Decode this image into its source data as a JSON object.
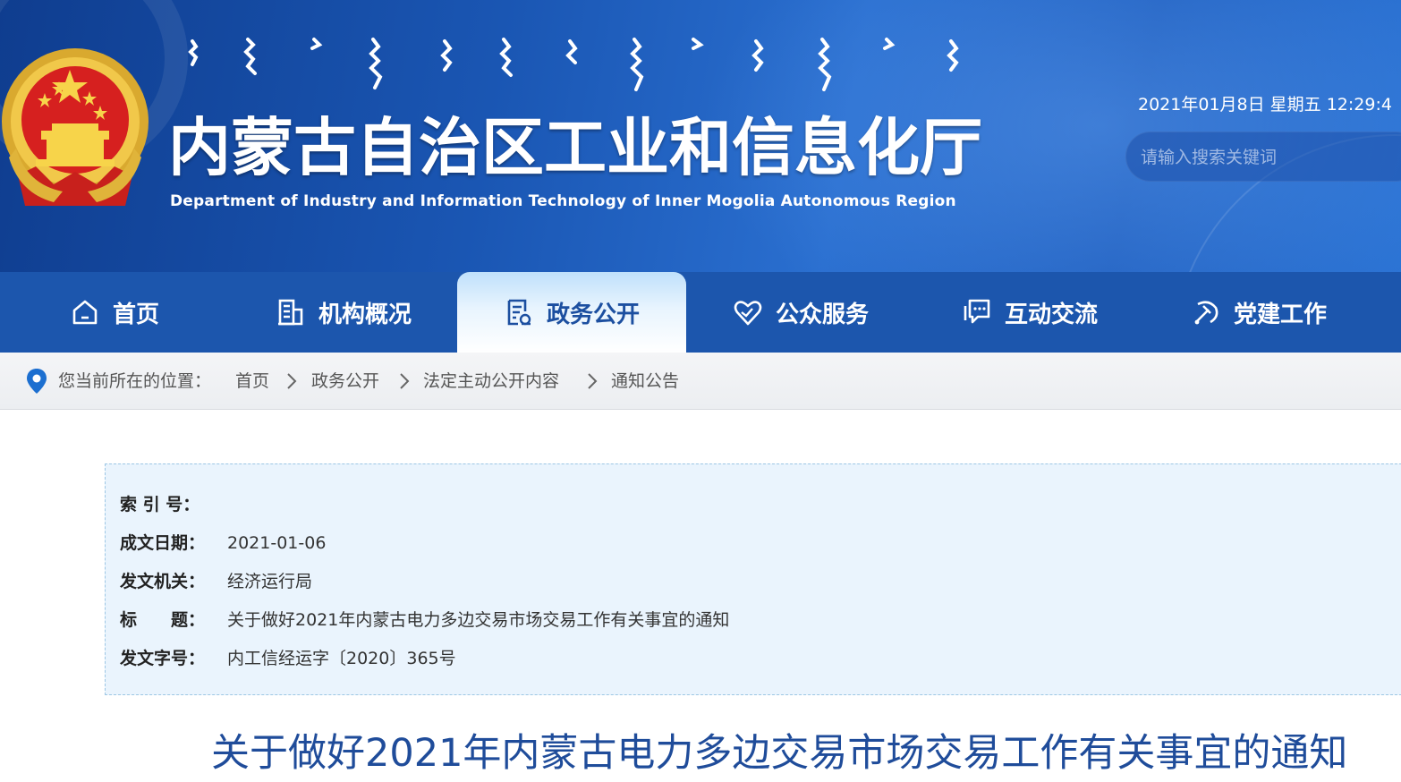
{
  "header": {
    "title_cn": "内蒙古自治区工业和信息化厅",
    "title_en": "Department of Industry and Information Technology of Inner Mogolia Autonomous Region",
    "datetime": "2021年01月8日 星期五 12:29:4",
    "search_placeholder": "请输入搜索关键词",
    "emblem_icon": "national-emblem-icon",
    "mongolian_script_icon": "mongolian-script-title-icon"
  },
  "nav": {
    "items": [
      {
        "label": "首页",
        "icon": "home-icon"
      },
      {
        "label": "机构概况",
        "icon": "building-icon"
      },
      {
        "label": "政务公开",
        "icon": "document-icon"
      },
      {
        "label": "公众服务",
        "icon": "heart-hands-icon"
      },
      {
        "label": "互动交流",
        "icon": "chat-icon"
      },
      {
        "label": "党建工作",
        "icon": "party-emblem-icon"
      }
    ],
    "active_index": 2
  },
  "breadcrumb": {
    "prefix": "您当前所在的位置：",
    "items": [
      "首页",
      "政务公开",
      "法定主动公开内容",
      "通知公告"
    ]
  },
  "info": {
    "rows": [
      {
        "key": "索 引 号：",
        "value": ""
      },
      {
        "key": "成文日期：",
        "value": "2021-01-06"
      },
      {
        "key": "发文机关：",
        "value": "经济运行局"
      },
      {
        "key": "标　　题：",
        "value": "关于做好2021年内蒙古电力多边交易市场交易工作有关事宜的通知"
      },
      {
        "key": "发文字号：",
        "value": "内工信经运字〔2020〕365号"
      }
    ]
  },
  "article": {
    "title": "关于做好2021年内蒙古电力多边交易市场交易工作有关事宜的通知"
  },
  "colors": {
    "nav_bg": "#1c56ad",
    "header_dark": "#0f3d8f",
    "title_blue": "#1f4c9a",
    "infobox_bg": "#eaf4fd"
  }
}
